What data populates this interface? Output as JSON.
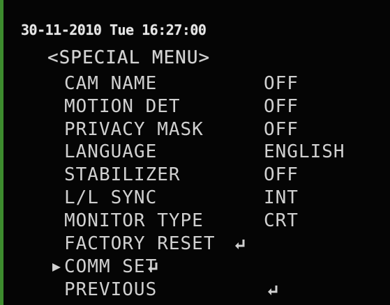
{
  "osd": {
    "timestamp": "30-11-2010 Tue 16:27:00",
    "title": "<SPECIAL MENU>",
    "items": [
      {
        "label": "CAM NAME",
        "value": "OFF"
      },
      {
        "label": "MOTION DET",
        "value": "OFF"
      },
      {
        "label": "PRIVACY MASK",
        "value": "OFF"
      },
      {
        "label": "LANGUAGE",
        "value": "ENGLISH"
      },
      {
        "label": "STABILIZER",
        "value": "OFF"
      },
      {
        "label": "L/L SYNC",
        "value": "INT"
      },
      {
        "label": "MONITOR TYPE",
        "value": "CRT"
      },
      {
        "label": "FACTORY RESET",
        "icon": "enter-icon"
      },
      {
        "label": "COMM SET",
        "icon": "enter-icon",
        "selected": true
      },
      {
        "label": "PREVIOUS",
        "icon": "enter-icon"
      }
    ]
  },
  "colors": {
    "background": "#050505",
    "text": "#d0d0d0",
    "edge": "#3d8c2e"
  }
}
